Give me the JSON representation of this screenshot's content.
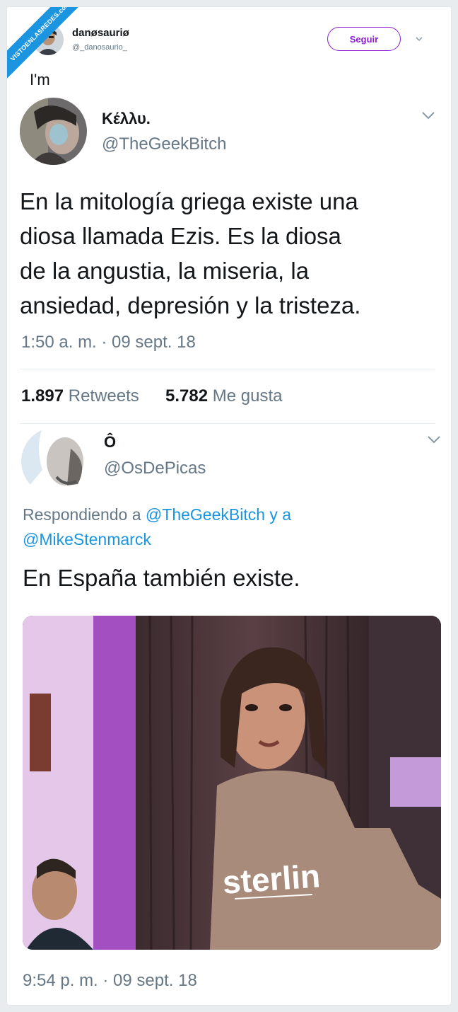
{
  "watermark": "VISTOENLASREDES.com",
  "outer": {
    "user_name": "danøsauriø",
    "user_handle": "@_danosaurio_",
    "follow_label": "Seguir",
    "caption": "I'm"
  },
  "quoted": {
    "user_name": "Κέλλυ.",
    "user_handle": "@TheGeekBitch",
    "text_lines": [
      "En la mitología griega existe una",
      "diosa llamada Ezis. Es la diosa",
      "de la angustia, la miseria, la",
      "ansiedad, depresión y la tristeza."
    ],
    "timestamp": "1:50 a. m. · 09 sept. 18",
    "retweets_count": "1.897",
    "retweets_label": "Retweets",
    "likes_count": "5.782",
    "likes_label": "Me gusta"
  },
  "reply": {
    "user_name": "Ô",
    "user_handle": "@OsDePicas",
    "replying_prefix": "Respondiendo a",
    "replying_user1": "@TheGeekBitch",
    "replying_joiner": "y a",
    "replying_user2": "@MikeStenmarck",
    "text": "En España también existe.",
    "image_shirt_text": "sterlin",
    "timestamp": "9:54 p. m. · 09 sept. 18"
  },
  "colors": {
    "accent_link": "#1b95e0",
    "follow_purple": "#8b1fd1",
    "muted": "#657786"
  }
}
